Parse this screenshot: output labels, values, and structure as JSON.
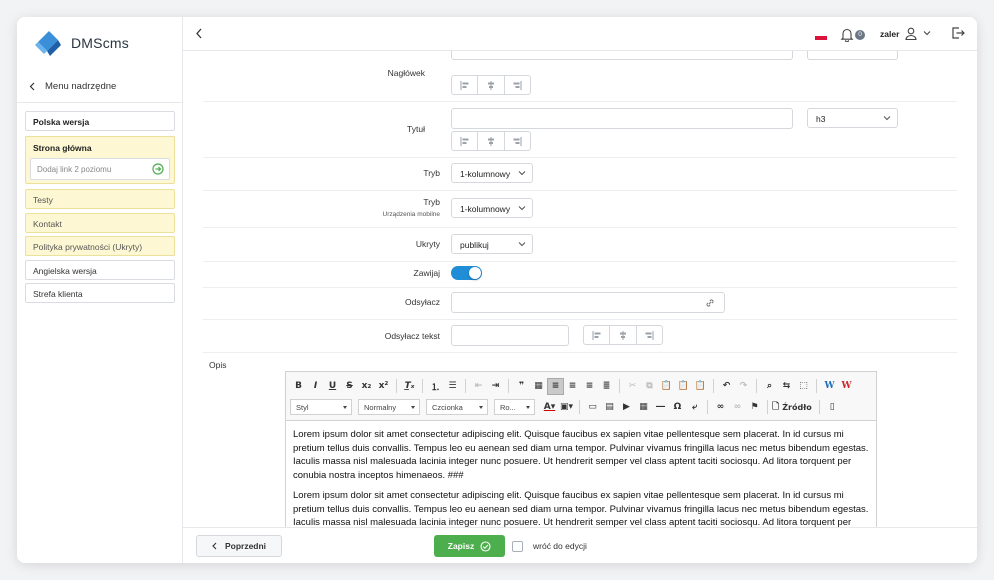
{
  "app": {
    "name": "DMScms"
  },
  "sidebar": {
    "parent_menu": "Menu nadrzędne",
    "items": [
      {
        "label": "Polska wersja"
      },
      {
        "label": "Strona główna"
      },
      {
        "label": "Dodaj link 2 poziomu"
      },
      {
        "label": "Testy"
      },
      {
        "label": "Kontakt"
      },
      {
        "label": "Polityka prywatności (Ukryty)"
      },
      {
        "label": "Angielska wersja"
      },
      {
        "label": "Strefa klienta"
      }
    ]
  },
  "header": {
    "notifications_count": "0",
    "username": "zaler"
  },
  "form": {
    "naglowek": {
      "label": "Nagłówek"
    },
    "tytul": {
      "label": "Tytuł",
      "heading_level": "h3"
    },
    "tryb": {
      "label": "Tryb",
      "value": "1-kolumnowy"
    },
    "tryb_mobile": {
      "label": "Tryb",
      "sublabel": "Urządzenia mobilne",
      "value": "1-kolumnowy"
    },
    "ukryty": {
      "label": "Ukryty",
      "value": "publikuj"
    },
    "zawijaj": {
      "label": "Zawijaj",
      "enabled": true
    },
    "odsylacz": {
      "label": "Odsyłacz"
    },
    "odsylacz_tekst": {
      "label": "Odsyłacz tekst"
    },
    "opis": {
      "label": "Opis"
    }
  },
  "editor": {
    "combos": {
      "style": "Styl",
      "format": "Normalny",
      "font": "Czcionka",
      "size": "Ro..."
    },
    "source_label": "Źródło",
    "paragraphs": [
      "Lorem ipsum dolor sit amet consectetur adipiscing elit. Quisque faucibus ex sapien vitae pellentesque sem placerat. In id cursus mi pretium tellus duis convallis. Tempus leo eu aenean sed diam urna tempor. Pulvinar vivamus fringilla lacus nec metus bibendum egestas. Iaculis massa nisl malesuada lacinia integer nunc posuere. Ut hendrerit semper vel class aptent taciti sociosqu. Ad litora torquent per conubia nostra inceptos himenaeos. ###",
      "Lorem ipsum dolor sit amet consectetur adipiscing elit. Quisque faucibus ex sapien vitae pellentesque sem placerat. In id cursus mi pretium tellus duis convallis. Tempus leo eu aenean sed diam urna tempor. Pulvinar vivamus fringilla lacus nec metus bibendum egestas. Iaculis massa nisl malesuada lacinia integer nunc posuere. Ut hendrerit semper vel class aptent taciti sociosqu. Ad litora torquent per conubia nostra inceptos himenaeos."
    ]
  },
  "footer": {
    "previous": "Poprzedni",
    "save": "Zapisz",
    "return_label": "wróć do edycji"
  },
  "colors": {
    "brand": "#1f8ed7",
    "save": "#4cae4c",
    "highlight": "#fdf8d3"
  }
}
